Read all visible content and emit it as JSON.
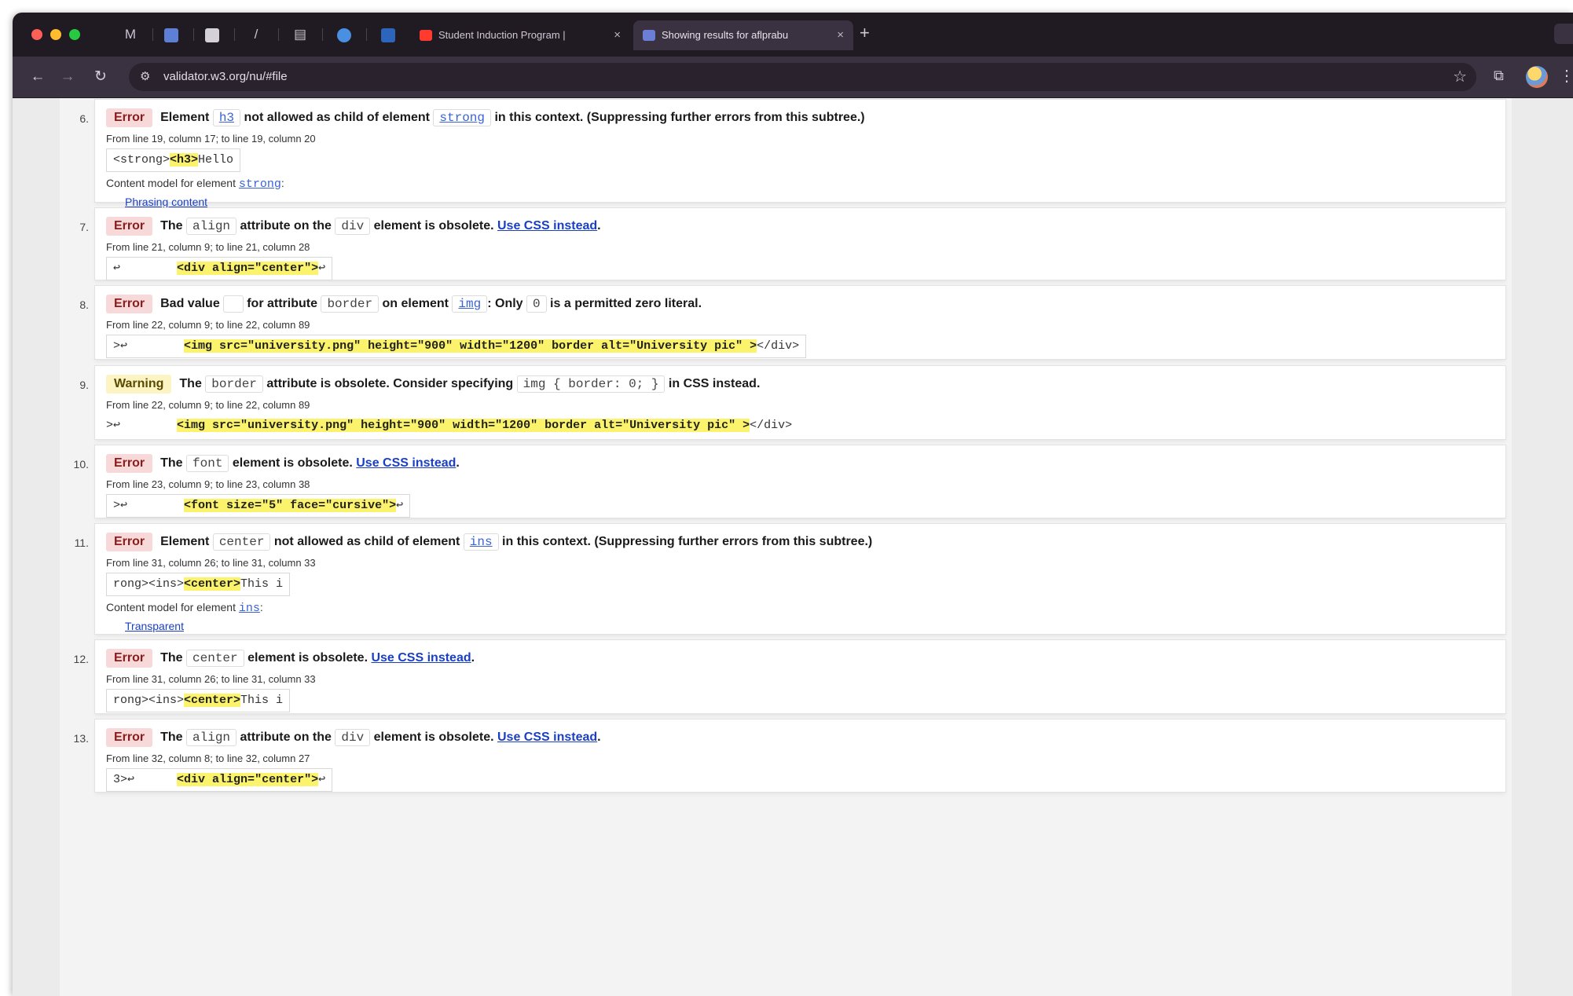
{
  "browser": {
    "tabs": [
      {
        "title": "Student Induction Program |",
        "favicon": "youtube-icon",
        "color": "#ff3b30"
      },
      {
        "title": "Showing results for aflprabu",
        "favicon": "w3c-icon",
        "color": "#6b7fd7"
      }
    ],
    "close_glyph": "×",
    "new_tab_glyph": "+",
    "url": "validator.w3.org/nu/#file",
    "nav": {
      "back": "←",
      "forward": "→",
      "reload": "↻"
    },
    "star": "☆"
  },
  "messages": [
    {
      "num": "6.",
      "type": "Error",
      "parts": [
        {
          "t": "Element "
        },
        {
          "c": "h3",
          "link": true
        },
        {
          "t": " not allowed as child of element "
        },
        {
          "c": "strong",
          "link": true
        },
        {
          "t": " in this context. (Suppressing further errors from this subtree.)"
        }
      ],
      "location": "From line 19, column 17; to line 19, column 20",
      "extract_pre": "<strong>",
      "extract_hl": "<h3>",
      "extract_post": "Hello",
      "content_model_label": "Content model for element ",
      "content_model_el": "strong",
      "content_model_colon": ":",
      "content_model_link": "Phrasing content"
    },
    {
      "num": "7.",
      "type": "Error",
      "parts": [
        {
          "t": "The "
        },
        {
          "c": "align"
        },
        {
          "t": " attribute on the "
        },
        {
          "c": "div"
        },
        {
          "t": " element is obsolete. "
        },
        {
          "a": "Use CSS instead"
        },
        {
          "t": "."
        }
      ],
      "location": "From line 21, column 9; to line 21, column 28",
      "extract_pre": "↩        ",
      "extract_hl": "<div align=\"center\">",
      "extract_post": "↩"
    },
    {
      "num": "8.",
      "type": "Error",
      "parts": [
        {
          "t": "Bad value "
        },
        {
          "c": ""
        },
        {
          "t": " for attribute "
        },
        {
          "c": "border"
        },
        {
          "t": " on element "
        },
        {
          "c": "img",
          "link": true
        },
        {
          "t": ": Only "
        },
        {
          "c": "0"
        },
        {
          "t": " is a permitted zero literal."
        }
      ],
      "location": "From line 22, column 9; to line 22, column 89",
      "extract_pre": ">↩        ",
      "extract_hl": "<img src=\"university.png\" height=\"900\" width=\"1200\" border alt=\"University pic\" >",
      "extract_post": "</div>"
    },
    {
      "num": "9.",
      "type": "Warning",
      "parts": [
        {
          "t": "The "
        },
        {
          "c": "border"
        },
        {
          "t": " attribute is obsolete. Consider specifying "
        },
        {
          "c": "img { border: 0; }"
        },
        {
          "t": " in CSS instead."
        }
      ],
      "location": "From line 22, column 9; to line 22, column 89",
      "extract_pre": ">↩        ",
      "extract_hl": "<img src=\"university.png\" height=\"900\" width=\"1200\" border alt=\"University pic\" >",
      "extract_post": "</div>",
      "plain_extract": true
    },
    {
      "num": "10.",
      "type": "Error",
      "parts": [
        {
          "t": "The "
        },
        {
          "c": "font"
        },
        {
          "t": " element is obsolete. "
        },
        {
          "a": "Use CSS instead"
        },
        {
          "t": "."
        }
      ],
      "location": "From line 23, column 9; to line 23, column 38",
      "extract_pre": ">↩        ",
      "extract_hl": "<font size=\"5\" face=\"cursive\">",
      "extract_post": "↩"
    },
    {
      "num": "11.",
      "type": "Error",
      "parts": [
        {
          "t": "Element "
        },
        {
          "c": "center"
        },
        {
          "t": " not allowed as child of element "
        },
        {
          "c": "ins",
          "link": true
        },
        {
          "t": " in this context. (Suppressing further errors from this subtree.)"
        }
      ],
      "location": "From line 31, column 26; to line 31, column 33",
      "extract_pre": "rong><ins>",
      "extract_hl": "<center>",
      "extract_post": "This i",
      "content_model_label": "Content model for element ",
      "content_model_el": "ins",
      "content_model_colon": ":",
      "content_model_link": "Transparent"
    },
    {
      "num": "12.",
      "type": "Error",
      "parts": [
        {
          "t": "The "
        },
        {
          "c": "center"
        },
        {
          "t": " element is obsolete. "
        },
        {
          "a": "Use CSS instead"
        },
        {
          "t": "."
        }
      ],
      "location": "From line 31, column 26; to line 31, column 33",
      "extract_pre": "rong><ins>",
      "extract_hl": "<center>",
      "extract_post": "This i"
    },
    {
      "num": "13.",
      "type": "Error",
      "parts": [
        {
          "t": "The "
        },
        {
          "c": "align"
        },
        {
          "t": " attribute on the "
        },
        {
          "c": "div"
        },
        {
          "t": " element is obsolete. "
        },
        {
          "a": "Use CSS instead"
        },
        {
          "t": "."
        }
      ],
      "location": "From line 32, column 8; to line 32, column 27",
      "extract_pre": "3>↩      ",
      "extract_hl": "<div align=\"center\">",
      "extract_post": "↩"
    }
  ]
}
